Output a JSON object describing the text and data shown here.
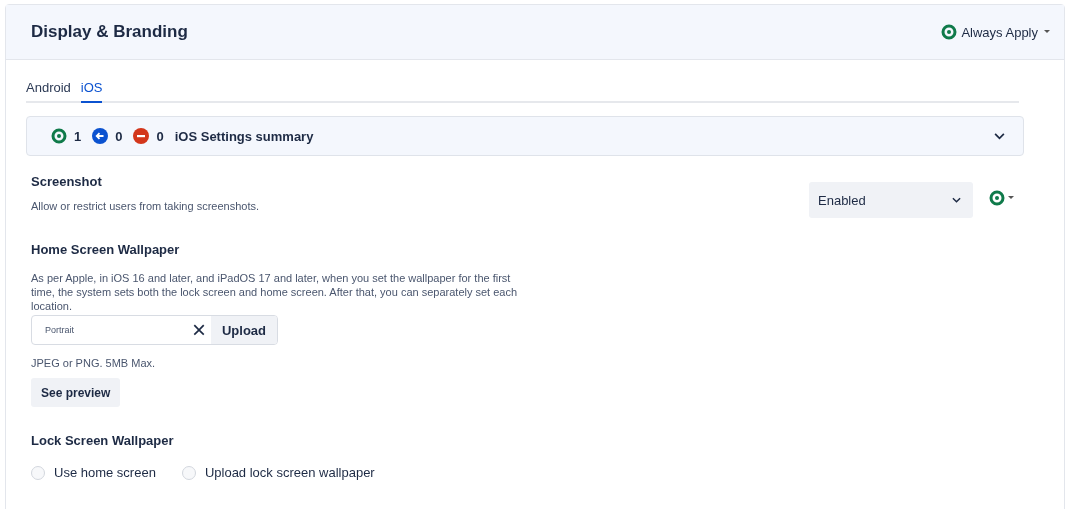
{
  "header": {
    "title": "Display & Branding",
    "apply_menu": {
      "label": "Always Apply",
      "kind": "applied"
    }
  },
  "tabs": [
    {
      "label": "Android",
      "selected": false
    },
    {
      "label": "iOS",
      "selected": true
    }
  ],
  "summary": {
    "counts": [
      {
        "kind": "applied",
        "count": "1"
      },
      {
        "kind": "inherited",
        "count": "0"
      },
      {
        "kind": "blocked",
        "count": "0"
      }
    ],
    "title": "iOS Settings summary",
    "expanded": false
  },
  "screenshot": {
    "title": "Screenshot",
    "description": "Allow or restrict users from taking screenshots.",
    "value": "Enabled",
    "status": {
      "kind": "applied"
    }
  },
  "home_wallpaper": {
    "title": "Home Screen Wallpaper",
    "description": "As per Apple, in iOS 16 and later, and iPadOS 17 and later, when you set the wallpaper for the first time, the system sets both the lock screen and home screen. After that, you can separately set each location.",
    "file_value": "Portrait",
    "clear": "×",
    "upload": "Upload",
    "hint": "JPEG or PNG. 5MB Max.",
    "preview": "See preview"
  },
  "lock_wallpaper": {
    "title": "Lock Screen Wallpaper",
    "options": [
      {
        "label": "Use home screen",
        "selected": false
      },
      {
        "label": "Upload lock screen wallpaper",
        "selected": false
      }
    ]
  }
}
